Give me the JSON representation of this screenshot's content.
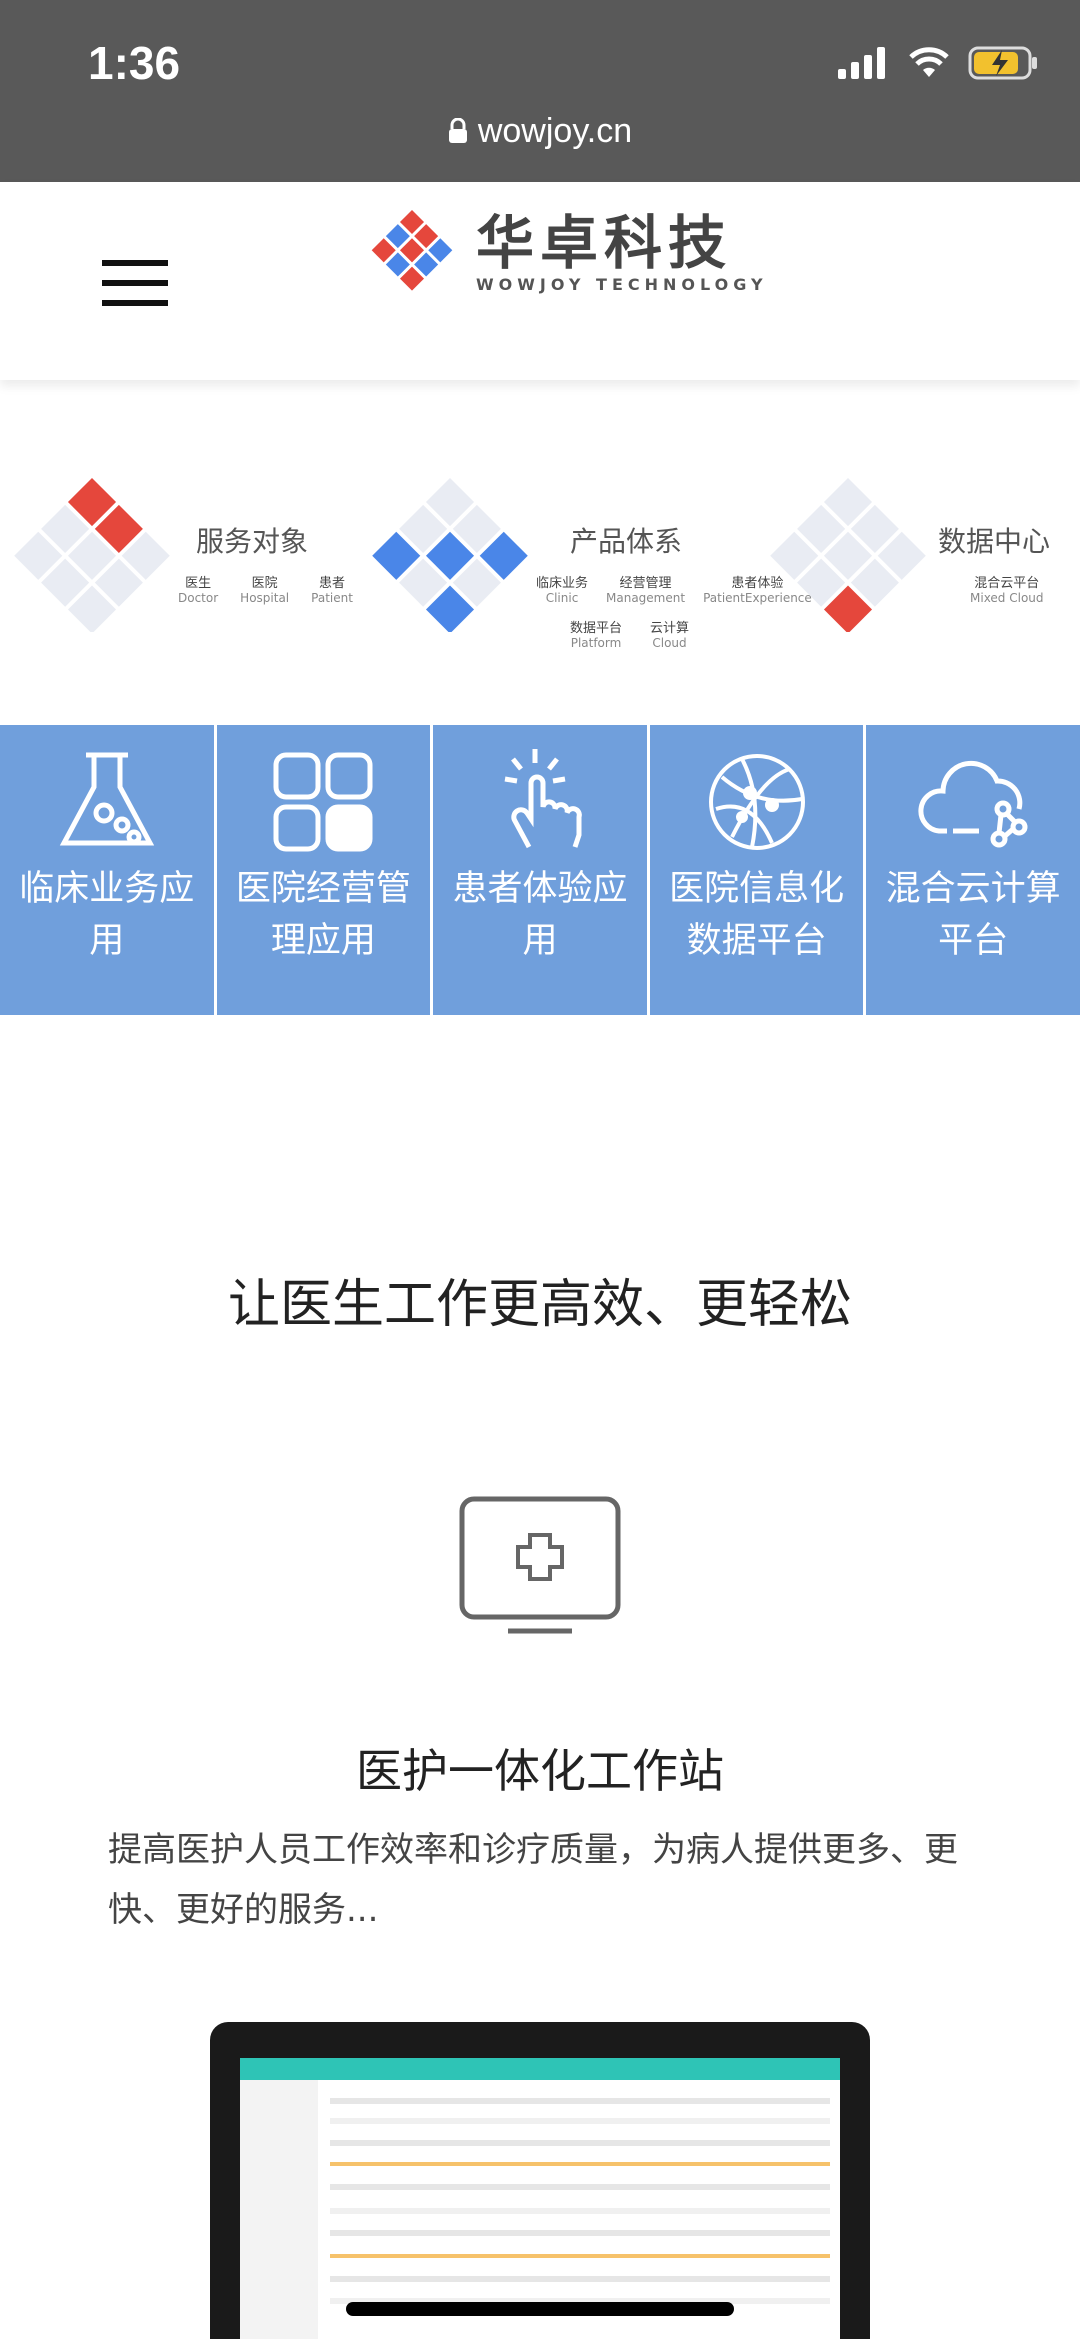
{
  "status_bar": {
    "time": "1:36",
    "url": "wowjoy.cn"
  },
  "header": {
    "logo_cn": "华卓科技",
    "logo_en": "WOWJOY TECHNOLOGY"
  },
  "categories": [
    {
      "title": "服务对象",
      "items": [
        {
          "cn": "医生",
          "en": "Doctor"
        },
        {
          "cn": "医院",
          "en": "Hospital"
        },
        {
          "cn": "患者",
          "en": "Patient"
        }
      ]
    },
    {
      "title": "产品体系",
      "items": [
        {
          "cn": "临床业务",
          "en": "Clinic"
        },
        {
          "cn": "经营管理",
          "en": "Management"
        },
        {
          "cn": "患者体验",
          "en": "PatientExperience"
        },
        {
          "cn": "数据平台",
          "en": "Platform"
        },
        {
          "cn": "云计算",
          "en": "Cloud"
        }
      ]
    },
    {
      "title": "数据中心",
      "items": [
        {
          "cn": "混合云平台",
          "en": "Mixed Cloud"
        }
      ]
    }
  ],
  "tiles": [
    {
      "label": "临床业务应用",
      "icon": "flask-icon"
    },
    {
      "label": "医院经营管理应用",
      "icon": "grid-icon"
    },
    {
      "label": "患者体验应用",
      "icon": "hand-tap-icon"
    },
    {
      "label": "医院信息化数据平台",
      "icon": "globe-network-icon"
    },
    {
      "label": "混合云计算平台",
      "icon": "cloud-network-icon"
    }
  ],
  "headline": "让医生工作更高效、更轻松",
  "workstation": {
    "title": "医护一体化工作站",
    "description": "提高医护人员工作效率和诊疗质量，为病人提供更多、更快、更好的服务..."
  },
  "colors": {
    "status_bar": "#595959",
    "tile_bg": "#709fdc",
    "logo_red": "#e5473c",
    "logo_blue": "#4a86e8"
  }
}
